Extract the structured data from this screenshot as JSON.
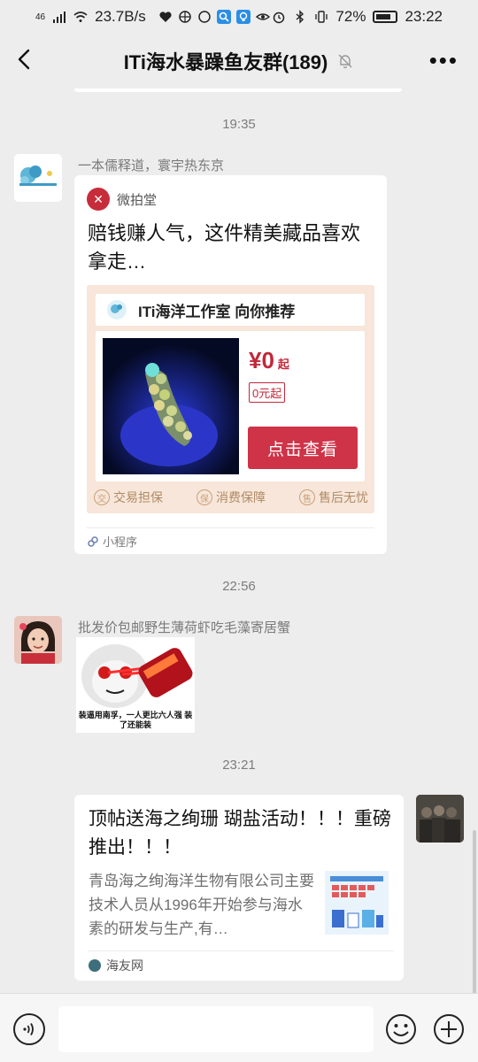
{
  "status_bar": {
    "network": "46",
    "speed": "23.7B/s",
    "battery": "72%",
    "time": "23:22"
  },
  "header": {
    "title": "ITi海水暴躁鱼友群(189)"
  },
  "messages": {
    "ts1": "19:35",
    "msg1": {
      "sender": "一本儒释道，寰宇热东京",
      "app_name": "微拍堂",
      "title": "赔钱赚人气，这件精美藏品喜欢拿走…",
      "shop": "ITi海洋工作室 向你推荐",
      "price": "¥0",
      "price_suffix": "起",
      "price_tag": "0元起",
      "cta": "点击查看",
      "guarantees": [
        "交易担保",
        "消费保障",
        "售后无忧"
      ],
      "guarantee_icons": [
        "交",
        "保",
        "售"
      ],
      "footer": "小程序"
    },
    "ts2": "22:56",
    "msg2": {
      "sender": "批发价包邮野生薄荷虾吃毛藻寄居蟹",
      "sticker_caption": "装逼用南孚，一人更比六人强 装了还能装"
    },
    "ts3": "23:21",
    "msg3": {
      "title": "顶帖送海之绚珊 瑚盐活动！！！重磅推出！！！",
      "desc": "青岛海之绚海洋生物有限公司主要技术人员从1996年开始参与海水素的研发与生产,有…",
      "source": "海友网"
    }
  },
  "input": {
    "placeholder": ""
  },
  "colors": {
    "accent": "#c2283a",
    "background": "#ededed"
  }
}
